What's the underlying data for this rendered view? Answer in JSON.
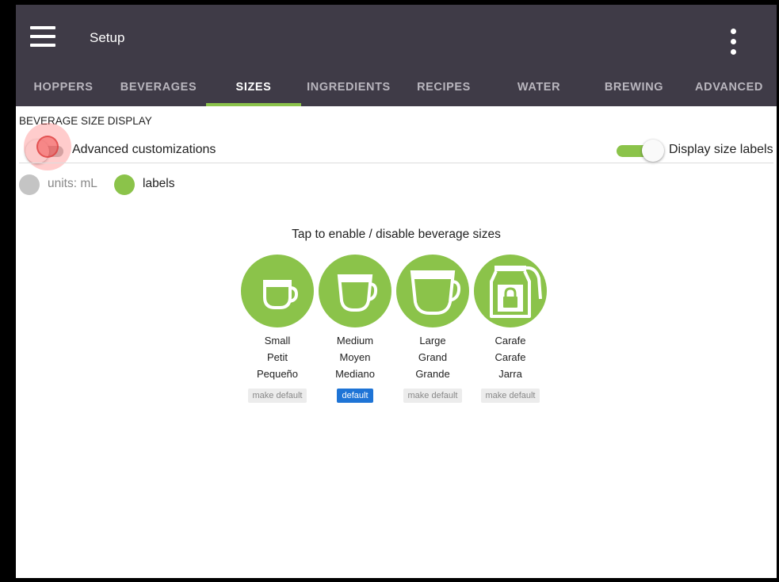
{
  "appbar": {
    "title": "Setup"
  },
  "tabs": [
    {
      "label": "HOPPERS",
      "active": false
    },
    {
      "label": "BEVERAGES",
      "active": false
    },
    {
      "label": "SIZES",
      "active": true
    },
    {
      "label": "INGREDIENTS",
      "active": false
    },
    {
      "label": "RECIPES",
      "active": false
    },
    {
      "label": "WATER",
      "active": false
    },
    {
      "label": "BREWING",
      "active": false
    },
    {
      "label": "ADVANCED",
      "active": false
    }
  ],
  "section": {
    "title": "BEVERAGE SIZE DISPLAY",
    "advanced_label": "Advanced customizations",
    "advanced_on": false,
    "display_labels_label": "Display size labels",
    "display_labels_on": true
  },
  "radios": [
    {
      "label": "units: mL",
      "selected": false
    },
    {
      "label": "labels",
      "selected": true
    }
  ],
  "hint": "Tap to enable / disable beverage sizes",
  "sizes": [
    {
      "icon": "small-cup-icon",
      "names": [
        "Small",
        "Petit",
        "Pequeño"
      ],
      "button": "make default",
      "is_default": false
    },
    {
      "icon": "medium-cup-icon",
      "names": [
        "Medium",
        "Moyen",
        "Mediano"
      ],
      "button": "default",
      "is_default": true
    },
    {
      "icon": "large-cup-icon",
      "names": [
        "Large",
        "Grand",
        "Grande"
      ],
      "button": "make default",
      "is_default": false
    },
    {
      "icon": "carafe-lock-icon",
      "names": [
        "Carafe",
        "Carafe",
        "Jarra"
      ],
      "button": "make default",
      "is_default": false
    }
  ],
  "colors": {
    "appbar": "#3f3b47",
    "accent": "#8bc34a",
    "default_button": "#1e74d6",
    "inactive": "#bdbdbd"
  }
}
